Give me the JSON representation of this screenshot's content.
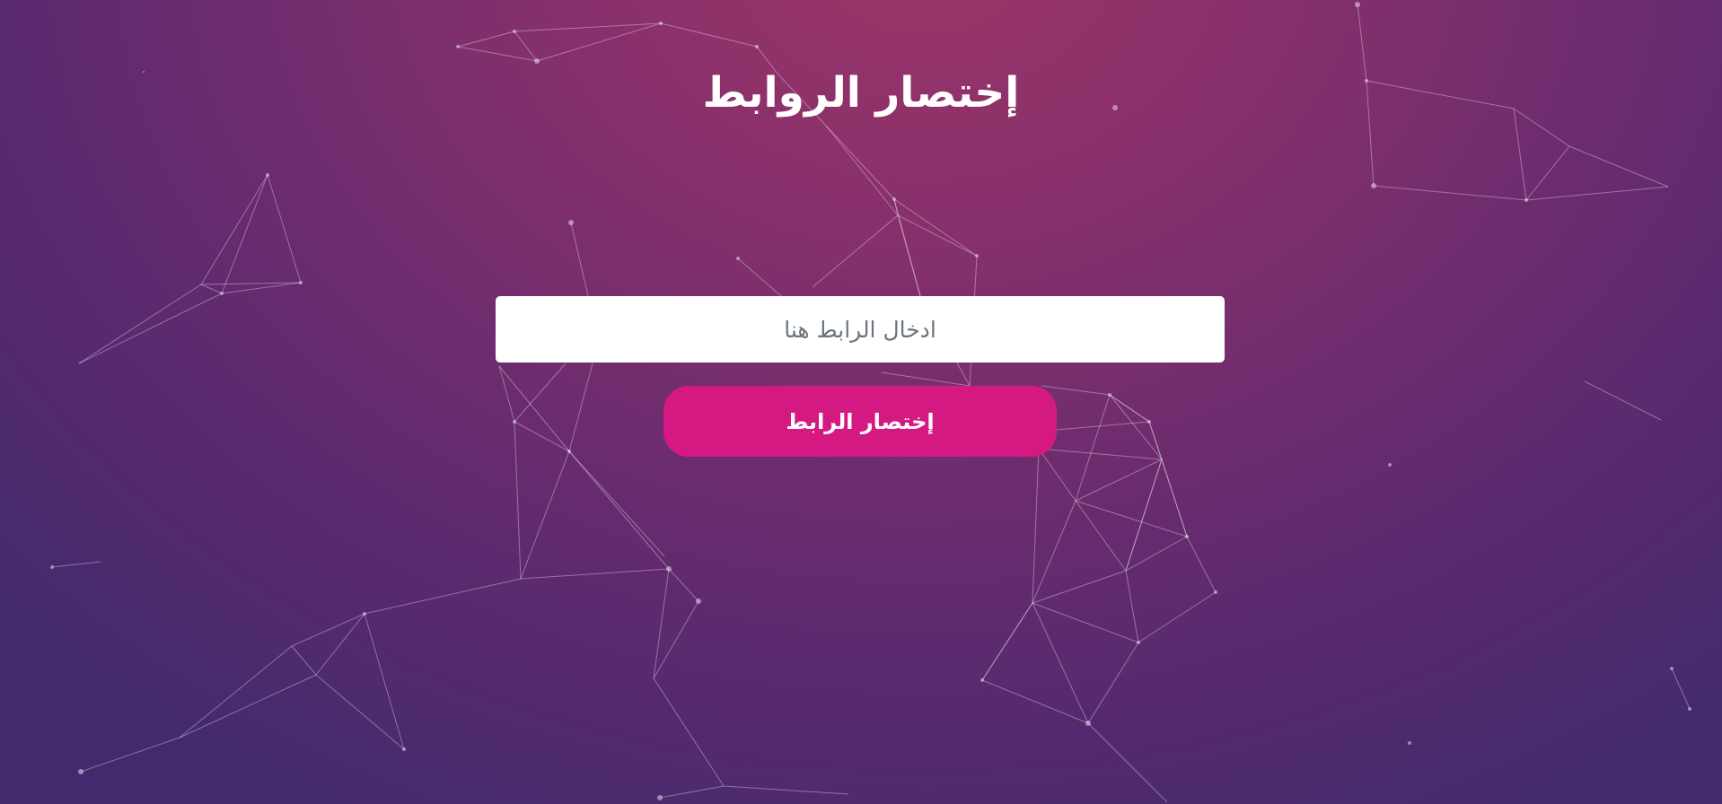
{
  "page": {
    "title": "إختصار الروابط"
  },
  "form": {
    "url_placeholder": "ادخال الرابط هنا",
    "url_value": "",
    "submit_label": "إختصار الرابط"
  },
  "colors": {
    "background_top": "#9c3468",
    "background_bottom": "#432a6e",
    "button": "#d41a82",
    "network_line": "#ffffff"
  }
}
